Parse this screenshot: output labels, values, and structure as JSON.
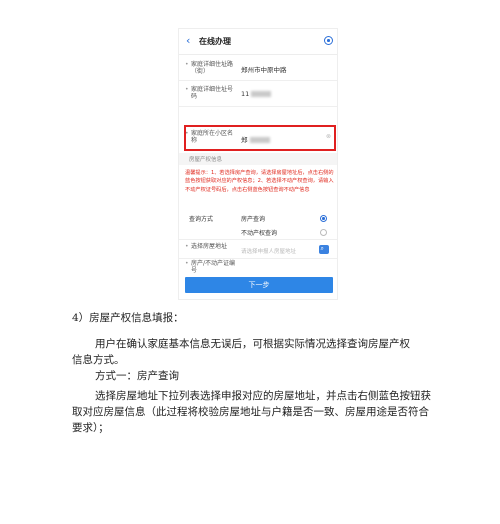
{
  "app": {
    "back_icon": "chevron-left-icon",
    "title": "在线办理",
    "target_icon": "target-icon"
  },
  "form": {
    "address_label": "家庭详细住址路（街）",
    "address_value": "郑州市中原中路",
    "house_number_label": "家庭详细住址号码",
    "house_number_value": "11",
    "community_label": "家庭所在小区名称",
    "community_value": "郑",
    "clear_icon": "clear-icon",
    "section_title": "房屋产权信息",
    "warning": "温馨提示：1、若选择房产查询，请选择房屋地址后，点击右侧的蓝色按钮获取对应的产权信息；2、若选择不动产权查询，请输入不动产权证号码后，点击右侧蓝色按钮查询不动产信息",
    "query_label": "查询方式",
    "option_house": "房产查询",
    "option_property": "不动产权查询",
    "select_address_label": "选择房屋地址",
    "select_address_placeholder": "请选择申报人房屋地址",
    "cert_label": "房产/不动产证编号",
    "next_button": "下一步"
  },
  "doc": {
    "p1": "4）房屋产权信息填报：",
    "p2_line1": "用户在确认家庭基本信息无误后，可根据实际情况选择查询房屋产权",
    "p2_line2": "信息方式。",
    "p3": "方式一：房产查询",
    "p4_line1": "选择房屋地址下拉列表选择申报对应的房屋地址，并点击右侧蓝色按钮获",
    "p4_line2": "取对应房屋信息（此过程将校验房屋地址与户籍是否一致、房屋用途是否符合",
    "p4_line3": "要求）；"
  }
}
